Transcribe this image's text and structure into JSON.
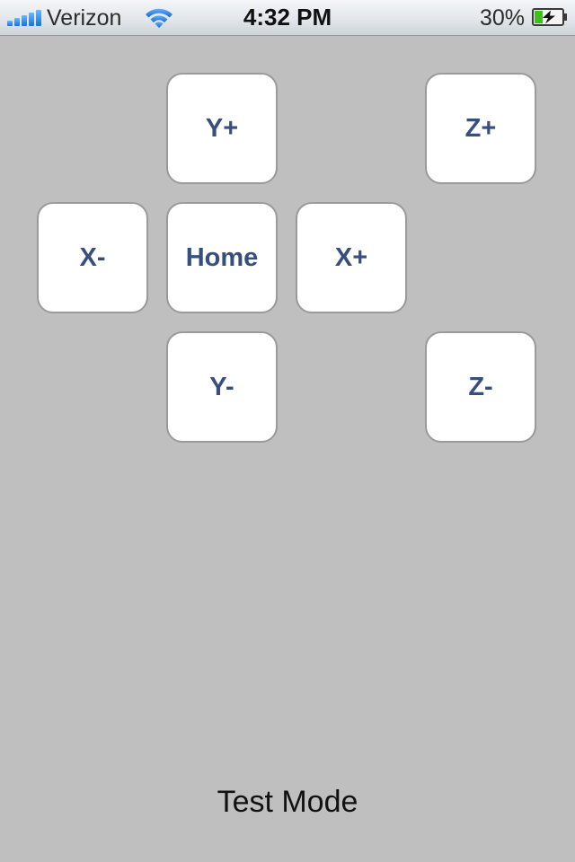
{
  "status_bar": {
    "carrier": "Verizon",
    "time": "4:32 PM",
    "battery_percent": "30%",
    "signal_icon": "signal-bars-icon",
    "wifi_icon": "wifi-icon",
    "battery_icon": "battery-charging-icon",
    "battery_level": 0.3
  },
  "controls": {
    "y_plus": "Y+",
    "z_plus": "Z+",
    "x_minus": "X-",
    "home": "Home",
    "x_plus": "X+",
    "y_minus": "Y-",
    "z_minus": "Z-"
  },
  "mode_label": "Test Mode",
  "colors": {
    "background": "#bfbfbf",
    "button_text": "#364f7e",
    "button_fill": "#ffffff",
    "battery_green": "#3ec11a"
  }
}
